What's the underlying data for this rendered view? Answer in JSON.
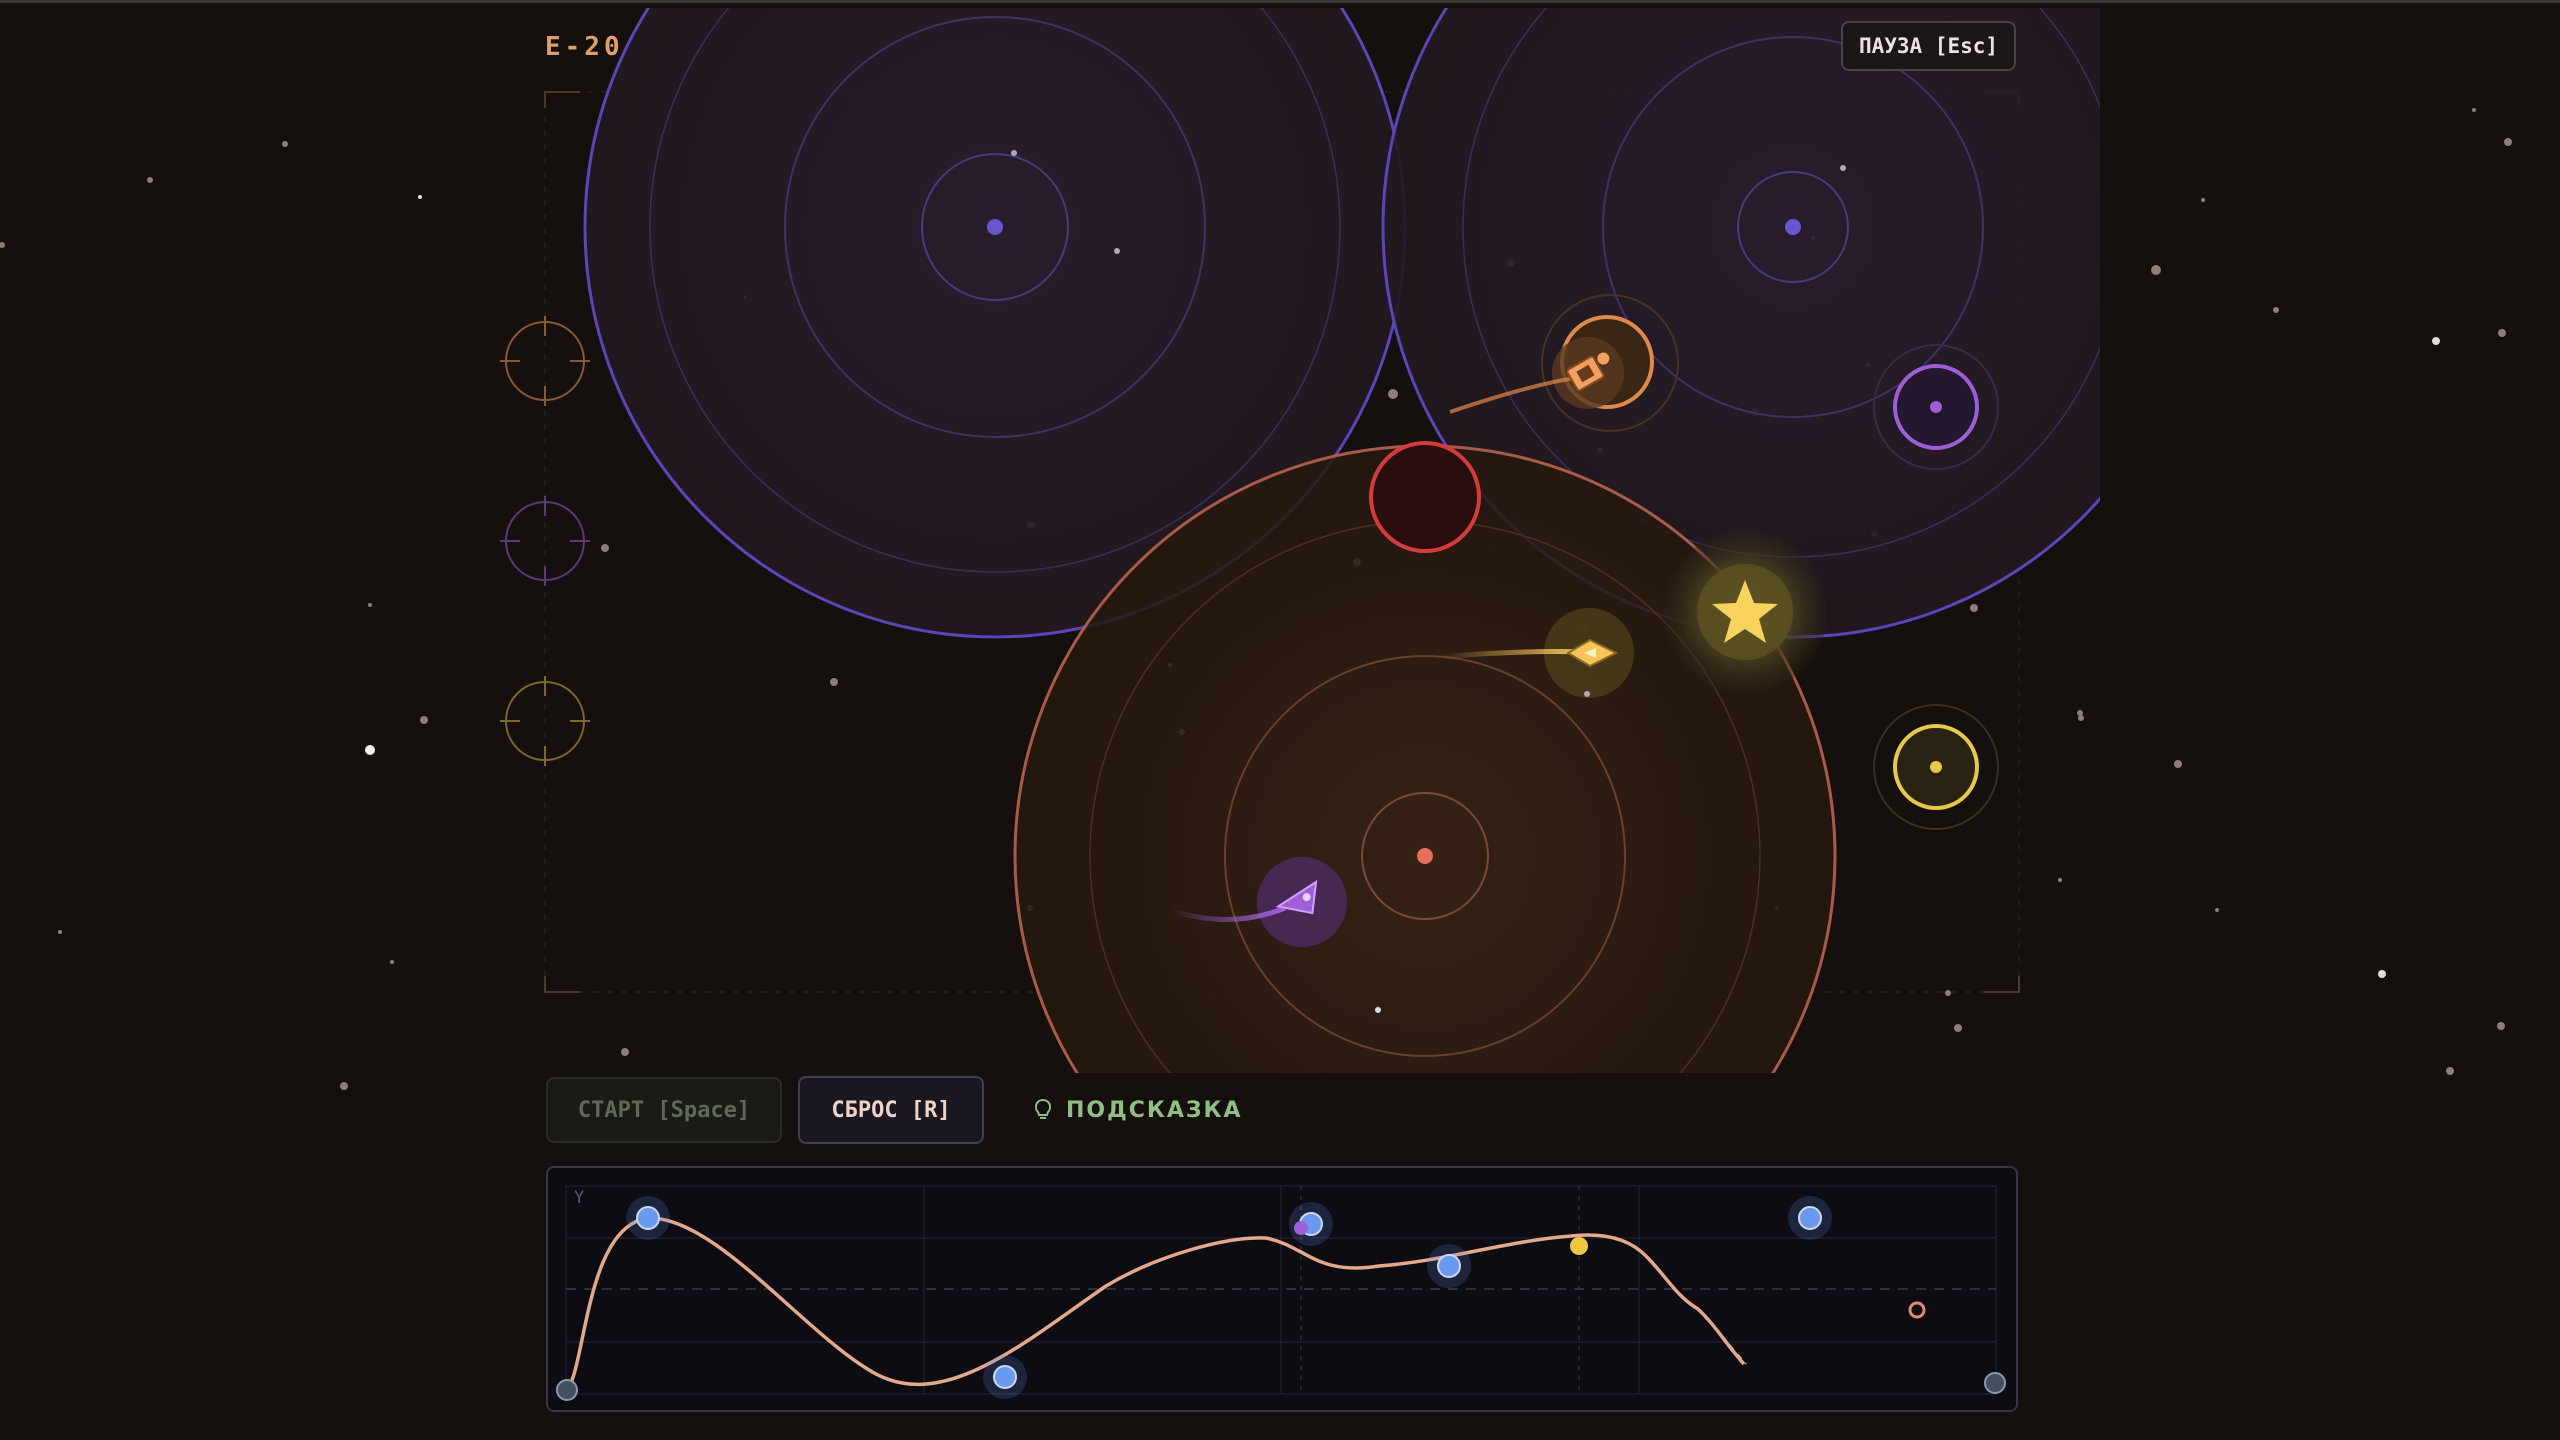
{
  "level": {
    "label": "E-20"
  },
  "pause_button": {
    "label": "ПАУЗА [Esc]"
  },
  "controls": {
    "start_label": "СТАРТ [Space]",
    "reset_label": "СБРОС [R]",
    "hint_label": "ПОДСКАЗКА"
  },
  "graph": {
    "y_axis_label": "Y",
    "control_point_count": 7
  },
  "colors": {
    "background": "#150f0d",
    "accent_orange": "#e0a06c",
    "planet_blue": "#6a55d0",
    "planet_red_core": "#e8705a",
    "hazard_red": "#d63b3b",
    "goal_purple": "#9d5fd6",
    "goal_gold": "#e8c84a",
    "star_yellow": "#f7d35c",
    "curve": "#e3a98a",
    "control_point": "#5d8ee8",
    "hint_green": "#8fbf83"
  },
  "icons": {
    "hint": "lightbulb-icon",
    "collectible": "star-icon",
    "player": "ship-icon"
  }
}
